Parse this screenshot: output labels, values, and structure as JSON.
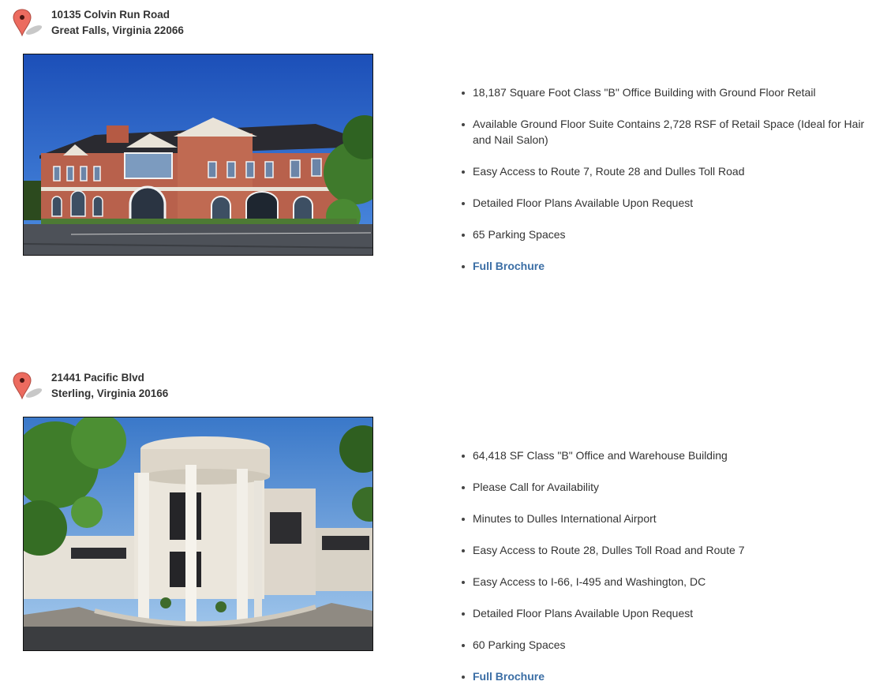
{
  "listings": [
    {
      "address_line1": "10135 Colvin Run Road",
      "address_line2": "Great Falls, Virginia 22066",
      "image": "photo of two-story red brick office building with arched windows and parking lot",
      "features": [
        "18,187 Square Foot Class \"B\" Office Building with Ground Floor Retail",
        "Available Ground Floor Suite Contains 2,728 RSF of Retail Space (Ideal for Hair and Nail Salon)",
        "Easy Access to Route 7, Route 28 and Dulles Toll Road",
        "Detailed Floor Plans Available Upon Request",
        "65 Parking Spaces"
      ],
      "brochure_label": "Full Brochure"
    },
    {
      "address_line1": "21441 Pacific Blvd",
      "address_line2": "Sterling, Virginia 20166",
      "image": "photo of white office and warehouse building with round columned entrance portico",
      "features": [
        "64,418 SF Class \"B\" Office and Warehouse Building",
        "Please Call for Availability",
        "Minutes to Dulles International Airport",
        "Easy Access to Route 28, Dulles Toll Road and Route 7",
        "Easy Access to I-66, I-495 and Washington, DC",
        "Detailed Floor Plans Available Upon Request",
        "60 Parking Spaces"
      ],
      "brochure_label": "Full Brochure"
    }
  ],
  "icons": {
    "pin": "map-pin-icon"
  },
  "colors": {
    "link": "#3b6ea5",
    "text": "#333333",
    "pin": "#e8655a"
  }
}
